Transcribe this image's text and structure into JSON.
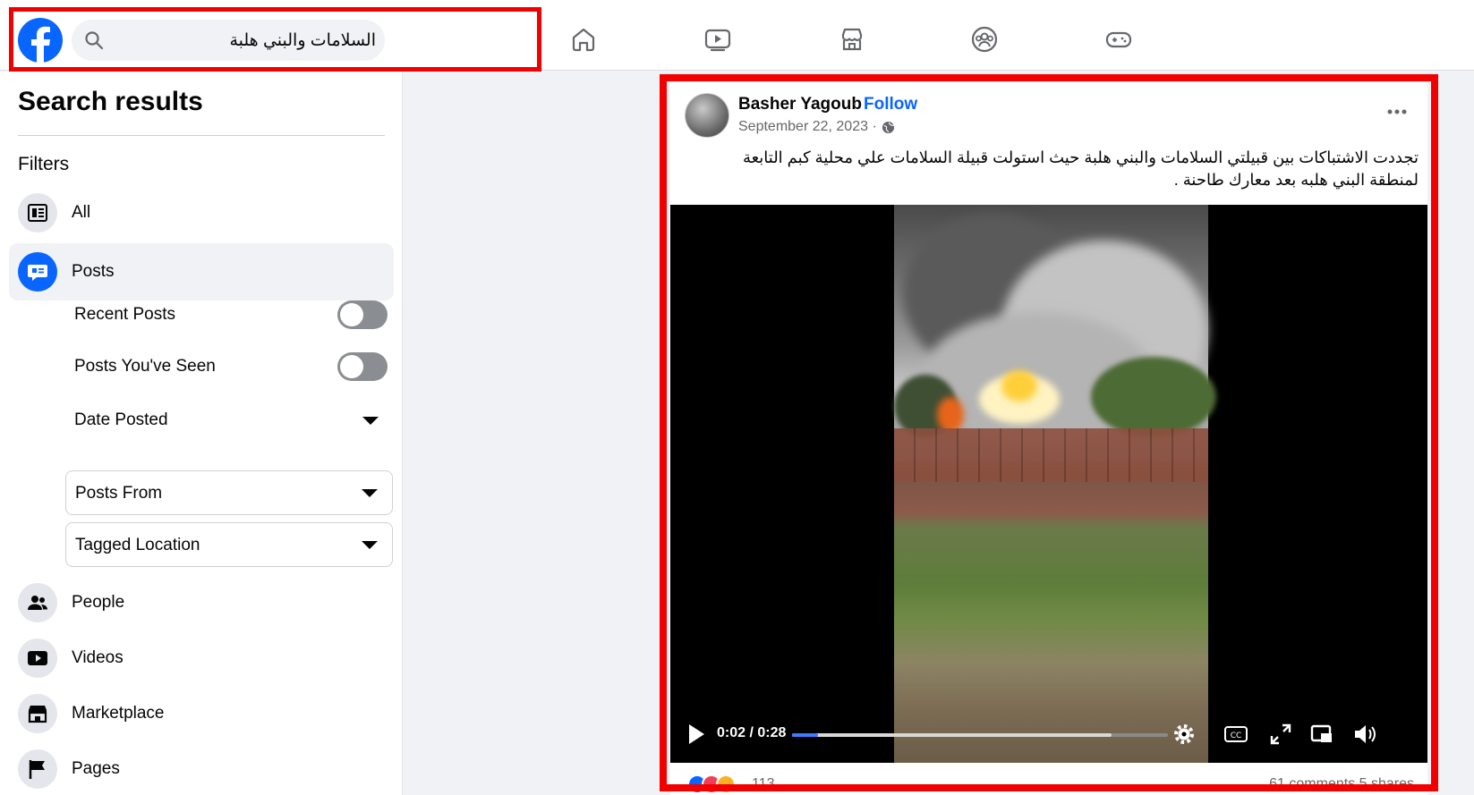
{
  "search": {
    "query": "السلامات والبني هلبة"
  },
  "nav": {
    "items": [
      "home-icon",
      "watch-icon",
      "marketplace-icon",
      "groups-icon",
      "gaming-icon"
    ]
  },
  "sidebar": {
    "title": "Search results",
    "filters_label": "Filters",
    "items": [
      {
        "label": "All",
        "icon": "feed-icon"
      },
      {
        "label": "Posts",
        "icon": "posts-icon",
        "active": true
      },
      {
        "label": "People",
        "icon": "people-icon"
      },
      {
        "label": "Videos",
        "icon": "video-icon"
      },
      {
        "label": "Marketplace",
        "icon": "shop-icon"
      },
      {
        "label": "Pages",
        "icon": "flag-icon"
      }
    ],
    "post_filters": {
      "recent_posts": {
        "label": "Recent Posts",
        "on": false
      },
      "posts_seen": {
        "label": "Posts You've Seen",
        "on": false
      },
      "date_posted": "Date Posted",
      "posts_from": "Posts From",
      "tagged_location": "Tagged Location"
    }
  },
  "post": {
    "author": "Basher Yagoub",
    "follow": "Follow",
    "separator": "·",
    "date": "September 22, 2023 ·",
    "text": "تجددت الاشتباكات بين قبيلتي السلامات والبني هلبة حيث استولت قبيلة السلامات علي محلية كبم التابعة لمنطقة البني هلبه بعد معارك طاحنة .",
    "video": {
      "time": "0:02 / 0:28",
      "progress_fraction": 0.07,
      "buffered_fraction": 0.85
    },
    "reactions_count": "113",
    "comments_shares": "61 comments  5 shares"
  },
  "colors": {
    "accent": "#0866ff",
    "highlight": "#f20000"
  }
}
